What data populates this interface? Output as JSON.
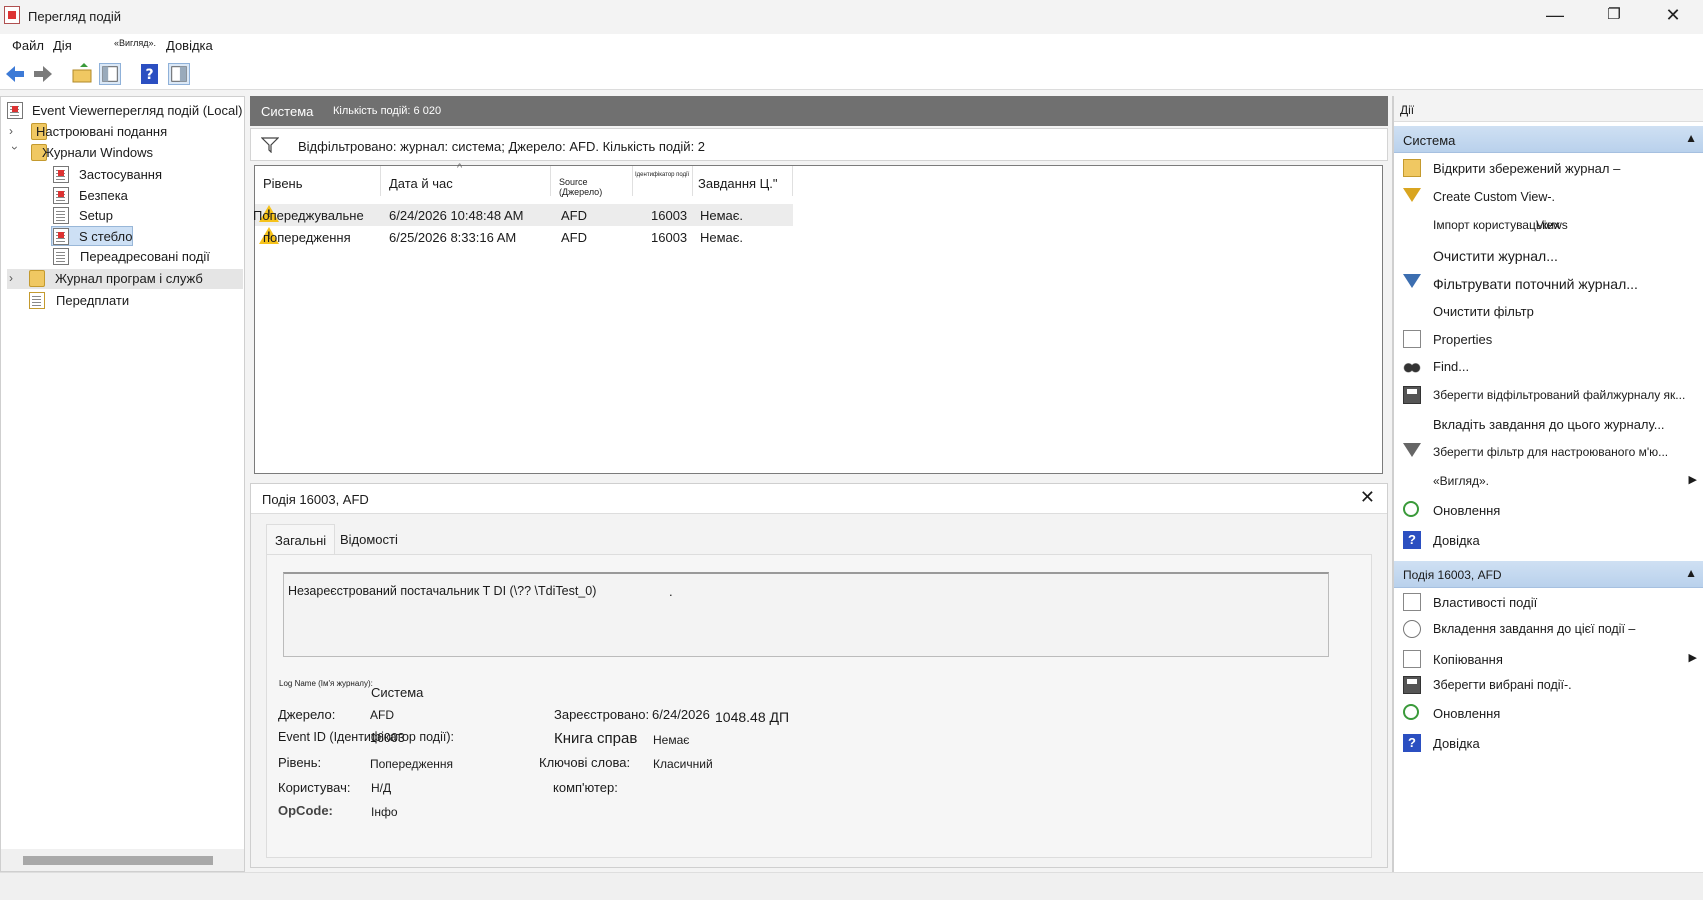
{
  "window": {
    "title": "Перегляд подій",
    "controls": {
      "minimize": "—",
      "restore": "❐",
      "close": "✕"
    }
  },
  "menu": [
    "Файл",
    "Дія",
    "«Вигляд».",
    "Довідка"
  ],
  "toolbar_icons": [
    "back-arrow-icon",
    "forward-arrow-icon",
    "up-folder-icon",
    "show-hide-tree-icon",
    "help-icon",
    "show-hide-actions-icon"
  ],
  "tree": {
    "root": "Event Viewerперегляд подій (Local)",
    "custom_views": "Настроювані подання",
    "windows_logs": "Журнали Windows",
    "app": "Застосування",
    "security": "Безпека",
    "setup": "Setup",
    "system": "S стебло",
    "forwarded": "Переадресовані події",
    "app_services": "Журнал програм і служб",
    "subscriptions": "Передплати"
  },
  "center": {
    "title": "Система",
    "count": "Кількість подій: 6 020",
    "filter": "Відфільтровано: журнал: система; Джерело: AFD. Кількість подій: 2",
    "columns": {
      "level": "Рівень",
      "date": "Дата й час",
      "source": "Source (Джерело)",
      "eventid": "Ідентифікатор події",
      "task": "Завдання Ц.\""
    },
    "rows": [
      {
        "level": "Попереджувальне",
        "date": "6/24/2026 10:48:48 AM",
        "source": "AFD",
        "id": "16003",
        "task": "Немає."
      },
      {
        "level": "попередження",
        "date": "6/25/2026 8:33:16 AM",
        "source": "AFD",
        "id": "16003",
        "task": "Немає."
      }
    ]
  },
  "detail": {
    "title": "Подія 16003, AFD",
    "close": "✕",
    "tabs": {
      "general": "Загальні",
      "details": "Відомості"
    },
    "description": "Незареєстрований постачальник T DI (\\?? \\TdiTest_0)",
    "description_end": ".",
    "labels": {
      "logname": "Log Name (Ім'я журналу):",
      "source": "Джерело:",
      "eventid": "Event ID (Ідентифікатор події):",
      "level": "Рівень:",
      "user": "Користувач:",
      "opcode": "OpCode:",
      "logged": "Зареєстровано:",
      "taskcat": "Книга справ",
      "keywords": "Ключові слова:",
      "computer": "комп'ютер:"
    },
    "values": {
      "logname": "Система",
      "source": "AFD",
      "eventid": "16003",
      "level": "Попередження",
      "user": "Н/Д",
      "opcode": "Інфо",
      "logged_date": "6/24/2026",
      "logged_time": "1048.48 ДП",
      "taskcat": "Немає",
      "keywords": "Класичний"
    }
  },
  "actions": {
    "header": "Дії",
    "section1": "Система",
    "items1": {
      "open": "Відкрити збережений журнал –",
      "create": "Create Custom View-.",
      "import": "Імпорт користувацьких",
      "import_overlay": "Views",
      "clear": "Очистити журнал...",
      "filter": "Фільтрувати поточний журнал...",
      "clearfilter": "Очистити фільтр",
      "properties": "Properties",
      "find": "Find...",
      "savefiltered": "Зберегти відфільтрований файлжурналу як...",
      "attach": "Вкладіть завдання до цього журналу...",
      "savefilter": "Зберегти фільтр для настроюваного м'ю...",
      "view": "«Вигляд».",
      "refresh": "Оновлення",
      "help": "Довідка"
    },
    "section2": "Подія 16003, AFD",
    "items2": {
      "eventprops": "Властивості події",
      "attachtask": "Вкладення завдання до цієї події –",
      "copy": "Копіювання",
      "saveselected": "Зберегти вибрані події-.",
      "refresh": "Оновлення",
      "help": "Довідка"
    },
    "submenu_arrow": "▶",
    "collapse_arrow": "▲",
    "help_glyph": "?"
  },
  "colors": {
    "section_header": "#b9d1ec",
    "center_header": "#707070",
    "warning": "#f6c21a"
  }
}
